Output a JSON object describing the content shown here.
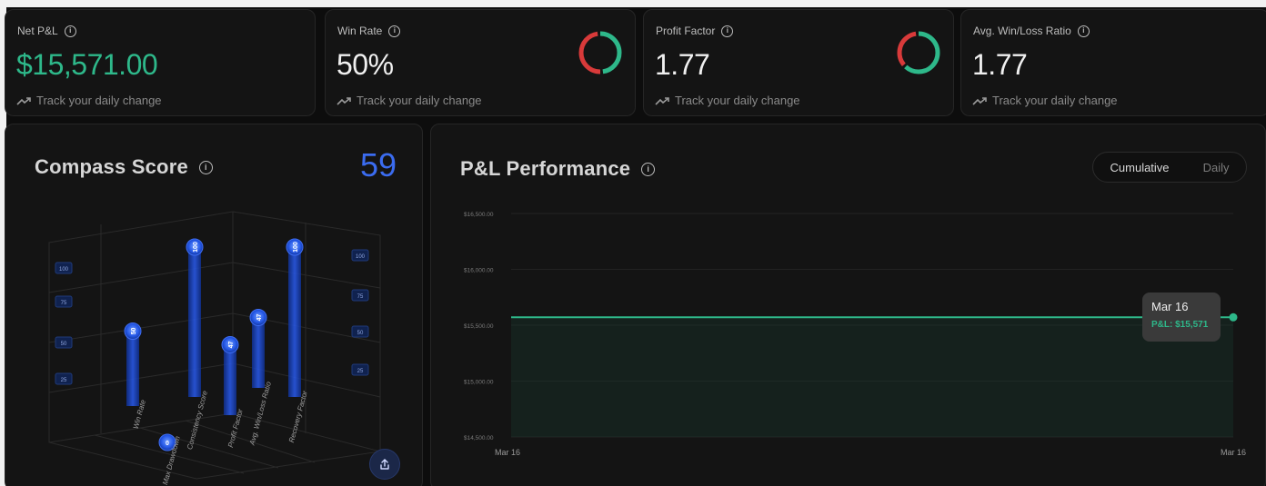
{
  "colors": {
    "green": "#2eb88a",
    "red": "#d83a3a",
    "blue": "#3b6cf0",
    "bar_blue": "#1f4fd6"
  },
  "stats": [
    {
      "label": "Net P&L",
      "value": "$15,571.00",
      "footer": "Track your daily change",
      "icon": "info-icon",
      "value_color": "green"
    },
    {
      "label": "Win Rate",
      "value": "50%",
      "footer": "Track your daily change",
      "icon": "info-icon",
      "ring": {
        "win_fraction": 0.5
      }
    },
    {
      "label": "Profit Factor",
      "value": "1.77",
      "footer": "Track your daily change",
      "icon": "info-icon",
      "ring": {
        "win_fraction": 0.64
      }
    },
    {
      "label": "Avg. Win/Loss Ratio",
      "value": "1.77",
      "footer": "Track your daily change",
      "icon": "info-icon"
    }
  ],
  "compass": {
    "title": "Compass Score",
    "score": "59",
    "share_icon": "share-icon",
    "bars": [
      {
        "label": "Win Rate",
        "value": "50"
      },
      {
        "label": "Max Drawdown",
        "value": "0"
      },
      {
        "label": "Consistency Score",
        "value": "100"
      },
      {
        "label": "Profit Factor",
        "value": "47"
      },
      {
        "label": "Avg. Win/Loss Ratio",
        "value": "47"
      },
      {
        "label": "Recovery Factor",
        "value": "100"
      }
    ],
    "left_axis_ticks": [
      "100",
      "75",
      "50",
      "25"
    ],
    "right_axis_ticks": [
      "100",
      "75",
      "50",
      "25"
    ]
  },
  "pnl": {
    "title": "P&L Performance",
    "toggle": {
      "active": "Cumulative",
      "inactive": "Daily"
    },
    "tooltip": {
      "date": "Mar 16",
      "value": "P&L: $15,571"
    },
    "chart_data": {
      "type": "line",
      "series": [
        {
          "values": [
            15571,
            15571
          ]
        }
      ],
      "x": [
        "Mar 16",
        "Mar 16"
      ],
      "ylim": [
        14500,
        16500
      ],
      "y_ticks": [
        "$16,500.00",
        "$16,000.00",
        "$15,500.00",
        "$15,000.00",
        "$14,500.00"
      ],
      "x_ticks": [
        "Mar 16",
        "Mar 16"
      ],
      "grid": true,
      "fill": "area"
    }
  }
}
